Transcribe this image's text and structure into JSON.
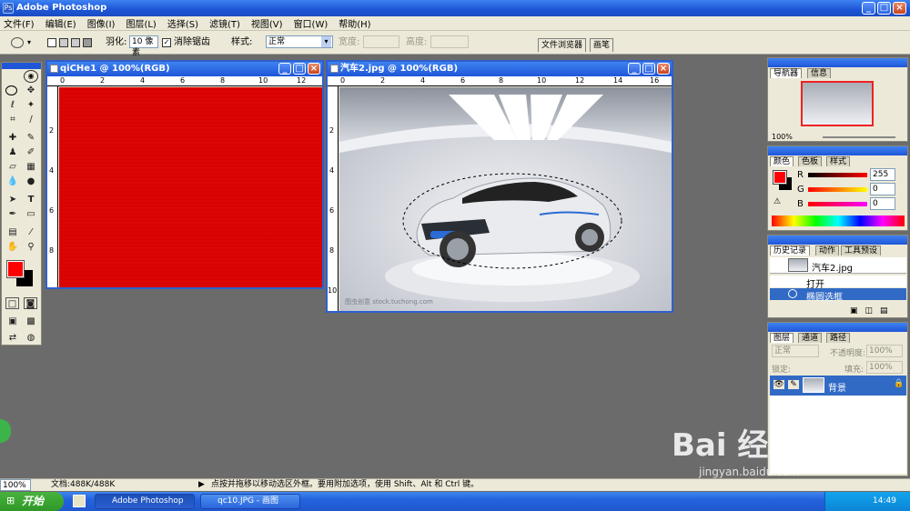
{
  "app": {
    "title": "Adobe Photoshop"
  },
  "menus": [
    "文件(F)",
    "编辑(E)",
    "图像(I)",
    "图层(L)",
    "选择(S)",
    "滤镜(T)",
    "视图(V)",
    "窗口(W)",
    "帮助(H)"
  ],
  "options": {
    "feather_label": "羽化:",
    "feather_value": "10 像素",
    "antialias_label": "消除锯齿",
    "style_label": "样式:",
    "style_value": "正常",
    "width_label": "宽度:",
    "height_label": "高度:",
    "tab_file_browser": "文件浏览器",
    "tab_brushes": "画笔"
  },
  "doc1": {
    "title": "qiCHe1 @ 100%(RGB)",
    "ruler": [
      "0",
      "2",
      "4",
      "6",
      "8",
      "10",
      "12"
    ],
    "vruler": [
      "2",
      "4",
      "6",
      "8"
    ]
  },
  "doc2": {
    "title": "汽车2.jpg @ 100%(RGB)",
    "ruler": [
      "0",
      "2",
      "4",
      "6",
      "8",
      "10",
      "12",
      "14",
      "16"
    ],
    "vruler": [
      "2",
      "4",
      "6",
      "8",
      "10"
    ],
    "watermark": "图虫创意 stock.tuchong.com"
  },
  "navigator": {
    "tab1": "导航器",
    "tab2": "信息",
    "zoom": "100%"
  },
  "color": {
    "tab1": "颜色",
    "tab2": "色板",
    "tab3": "样式",
    "r_label": "R",
    "g_label": "G",
    "b_label": "B",
    "r": "255",
    "g": "0",
    "b": "0"
  },
  "history": {
    "tab1": "历史记录",
    "tab2": "动作",
    "tab3": "工具预设",
    "snapshot": "汽车2.jpg",
    "items": [
      "打开",
      "椭圆选框"
    ]
  },
  "layers": {
    "tab1": "图层",
    "tab2": "通道",
    "tab3": "路径",
    "blend": "正常",
    "opacity_label": "不透明度:",
    "opacity": "100%",
    "lock_label": "锁定:",
    "fill_label": "填充:",
    "fill": "100%",
    "layer_name": "背景"
  },
  "status": {
    "zoom": "100%",
    "doc_info": "文档:488K/488K",
    "hint": "点按并拖移以移动选区外框。要用附加选项，使用 Shift、Alt 和 Ctrl 键。"
  },
  "taskbar": {
    "start": "开始",
    "task1": "Adobe Photoshop",
    "task2": "qc10.JPG - 画图",
    "clock": "14:49"
  },
  "watermark": {
    "brand": "Bai 经验",
    "url": "jingyan.baidu.com"
  },
  "colors": {
    "fg": "#ff0000",
    "bg": "#000000",
    "red_canvas": "#ec1c1c",
    "title_blue": "#1f56d8"
  }
}
